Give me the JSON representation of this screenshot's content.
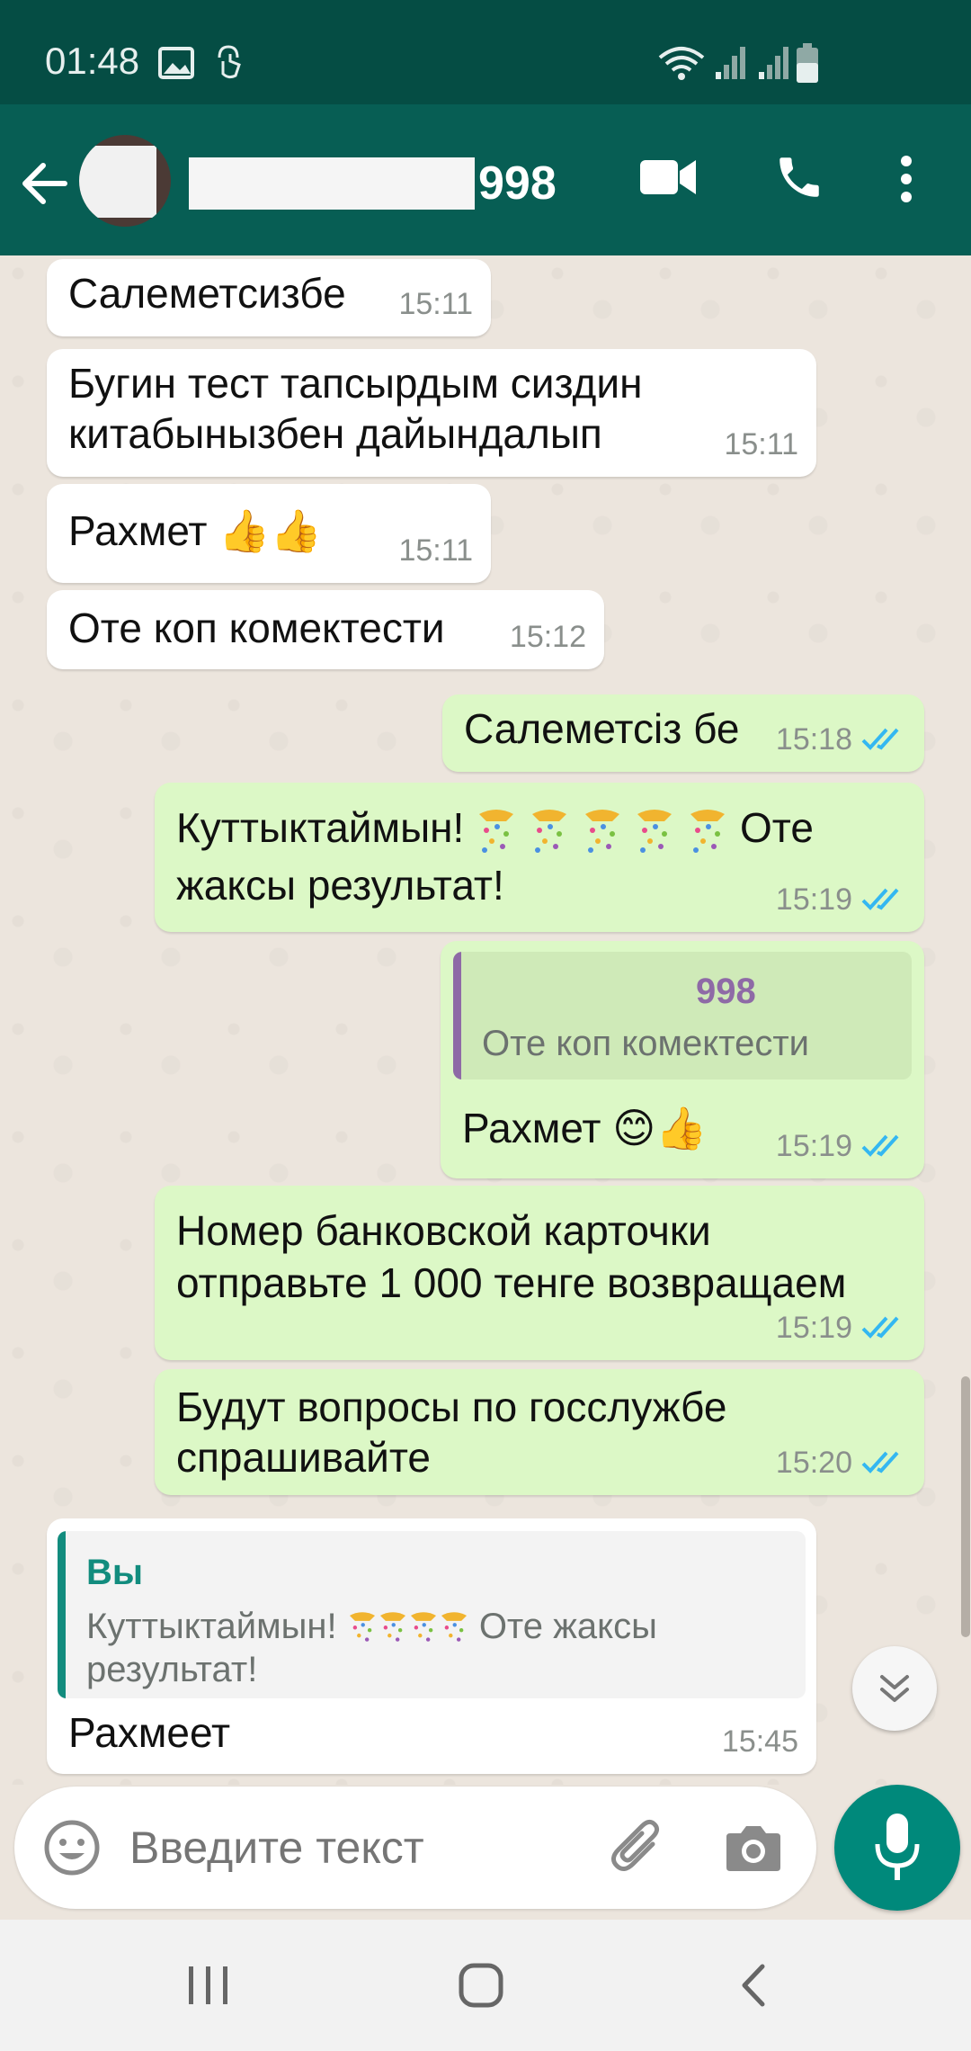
{
  "status_bar": {
    "time": "01:48",
    "icons": [
      "image-icon",
      "touch-icon",
      "wifi-icon",
      "signal-icon",
      "signal-icon",
      "battery-icon"
    ]
  },
  "header": {
    "contact_suffix": "998",
    "icons": [
      "back-arrow-icon",
      "video-call-icon",
      "phone-call-icon",
      "more-vertical-icon"
    ]
  },
  "messages": [
    {
      "dir": "in",
      "text": "Салеметсизбе",
      "time": "15:11"
    },
    {
      "dir": "in",
      "line1": "Бугин тест тапсырдым сиздин",
      "line2": "китабынызбен дайындалып",
      "time": "15:11"
    },
    {
      "dir": "in",
      "text": "Рахмет",
      "emoji": "👍👍",
      "time": "15:11"
    },
    {
      "dir": "in",
      "text": "Оте коп комектести",
      "time": "15:12"
    },
    {
      "dir": "out",
      "text": "Салеметсіз бе",
      "time": "15:18",
      "status": "read"
    },
    {
      "dir": "out",
      "line1_a": "Куттыктаймын!",
      "line1_b": "Оте",
      "line2": "жаксы результат!",
      "time": "15:19",
      "status": "read"
    },
    {
      "dir": "out",
      "quote_name": "998",
      "quote_text": "Оте коп комектести",
      "text": "Рахмет",
      "emoji": "😊👍",
      "time": "15:19",
      "status": "read"
    },
    {
      "dir": "out",
      "line1": "Номер банковской карточки",
      "line2": "отправьте 1 000 тенге возвращаем",
      "time": "15:19",
      "status": "read"
    },
    {
      "dir": "out",
      "line1": "Будут вопросы по госслужбе",
      "line2": "спрашивайте",
      "time": "15:20",
      "status": "read"
    },
    {
      "dir": "in",
      "quote_name": "Вы",
      "quote_line1_a": "Куттыктаймын!",
      "quote_line1_b": "Оте жаксы",
      "quote_line2": "результат!",
      "text": "Рахмеет",
      "time": "15:45"
    }
  ],
  "composer": {
    "placeholder": "Введите текст"
  },
  "colors": {
    "header": "#075e54",
    "statusbar": "#054d44",
    "outgoing_bubble": "#dcf8c6",
    "incoming_bubble": "#ffffff",
    "accent": "#00897b",
    "read_ticks": "#34b7f1",
    "quote_you": "#128c7e",
    "quote_contact": "#8e6aa6"
  }
}
